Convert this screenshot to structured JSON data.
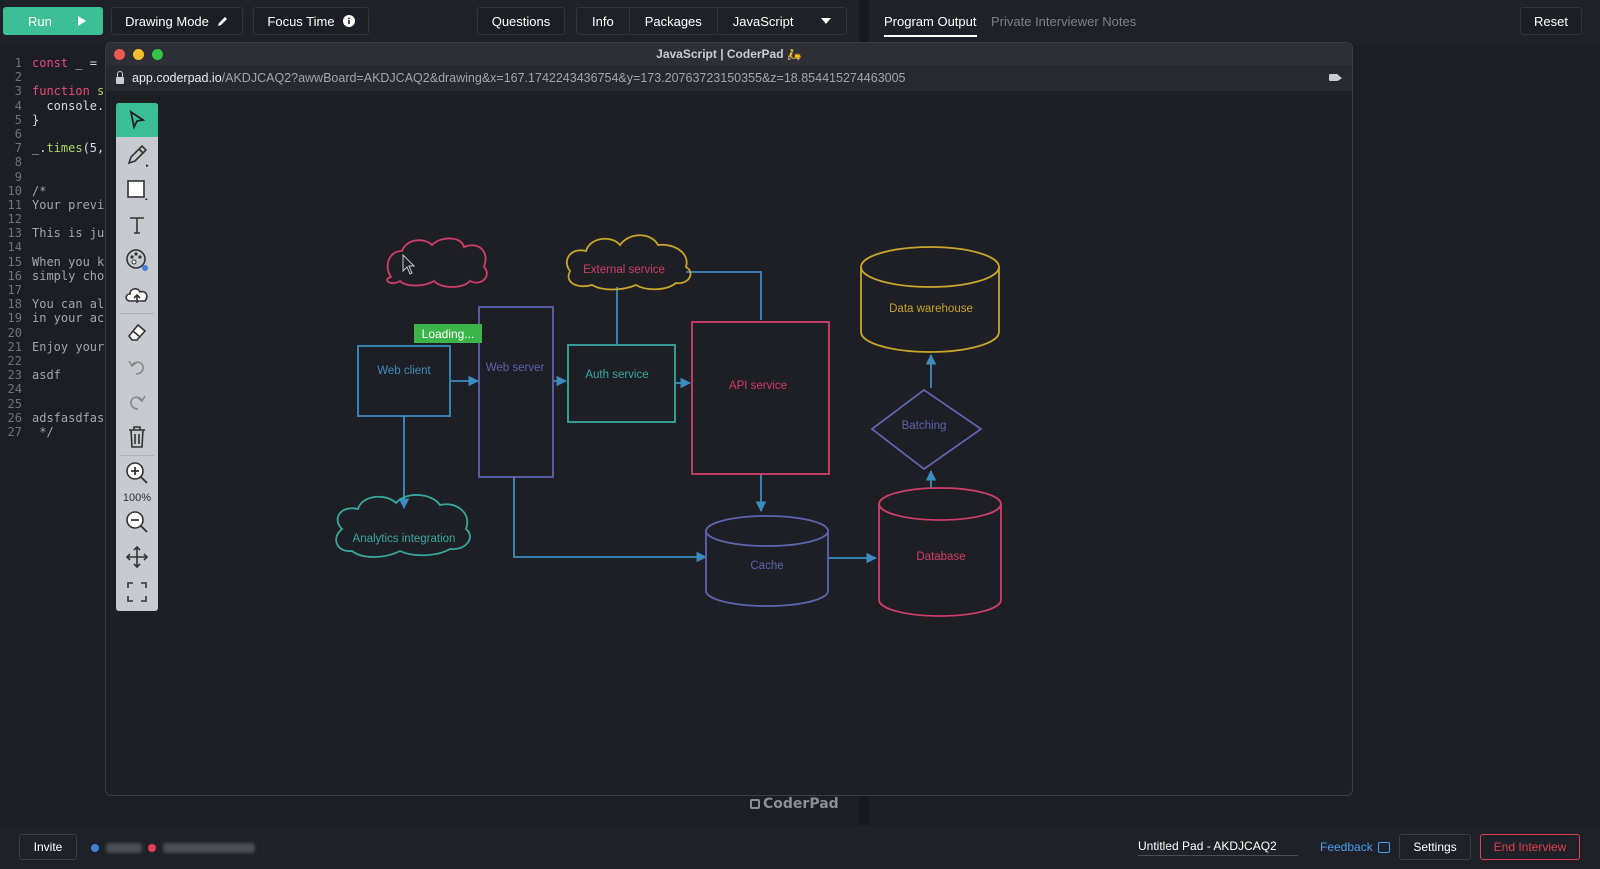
{
  "topbar": {
    "run_label": "Run",
    "drawing_mode_label": "Drawing Mode",
    "focus_time_label": "Focus Time",
    "questions_label": "Questions",
    "info_label": "Info",
    "packages_label": "Packages",
    "language_label": "JavaScript",
    "program_output_label": "Program Output",
    "interviewer_notes_label": "Private Interviewer Notes",
    "reset_label": "Reset"
  },
  "editor": {
    "lines": [
      {
        "n": "1",
        "text": ""
      },
      {
        "n": "2",
        "text": ""
      },
      {
        "n": "3",
        "text": ""
      },
      {
        "n": "4",
        "text": "  console."
      },
      {
        "n": "5",
        "text": "}"
      },
      {
        "n": "6",
        "text": ""
      },
      {
        "n": "7",
        "text": ""
      },
      {
        "n": "8",
        "text": ""
      },
      {
        "n": "9",
        "text": ""
      },
      {
        "n": "10",
        "text": "/*"
      },
      {
        "n": "11",
        "text": "Your previ"
      },
      {
        "n": "12",
        "text": ""
      },
      {
        "n": "13",
        "text": "This is ju"
      },
      {
        "n": "14",
        "text": ""
      },
      {
        "n": "15",
        "text": "When you k"
      },
      {
        "n": "16",
        "text": "simply cho"
      },
      {
        "n": "17",
        "text": ""
      },
      {
        "n": "18",
        "text": "You can al"
      },
      {
        "n": "19",
        "text": "in your ac"
      },
      {
        "n": "20",
        "text": ""
      },
      {
        "n": "21",
        "text": "Enjoy your"
      },
      {
        "n": "22",
        "text": ""
      },
      {
        "n": "23",
        "text": "asdf"
      },
      {
        "n": "24",
        "text": ""
      },
      {
        "n": "25",
        "text": ""
      },
      {
        "n": "26",
        "text": "adsfasdfas"
      },
      {
        "n": "27",
        "text": " */"
      }
    ],
    "line1_kw": "const",
    "line1_rest": " _ =",
    "line3_kw": "function",
    "line3_rest": " s",
    "line7_prefix": "_.",
    "line7_fn": "times",
    "line7_rest": "(5,"
  },
  "window": {
    "title": "JavaScript | CoderPad 🛵",
    "url_host": "app.coderpad.io",
    "url_path": "/AKDJCAQ2?awwBoard=AKDJCAQ2&drawing&x=167.1742243436754&y=173.20763723150355&z=18.854415274463005",
    "zoom_level": "100%",
    "loading_label": "Loading..."
  },
  "diagram": {
    "nodes": {
      "external_service": "External service",
      "data_warehouse": "Data warehouse",
      "web_client": "Web client",
      "web_server": "Web server",
      "auth_service": "Auth service",
      "api_service": "API service",
      "batching": "Batching",
      "analytics": "Analytics integration",
      "cache": "Cache",
      "database": "Database"
    },
    "colors": {
      "blue": "#3d8cc0",
      "purple": "#5d64b0",
      "teal": "#37a8a0",
      "pink": "#d23d6a",
      "yellow": "#c9a52b"
    }
  },
  "watermark": "CoderPad",
  "bottombar": {
    "invite_label": "Invite",
    "pad_name": "Untitled Pad - AKDJCAQ2",
    "feedback_label": "Feedback",
    "settings_label": "Settings",
    "end_interview_label": "End Interview",
    "user1_color": "#3f82d6",
    "user2_color": "#e2404e"
  }
}
